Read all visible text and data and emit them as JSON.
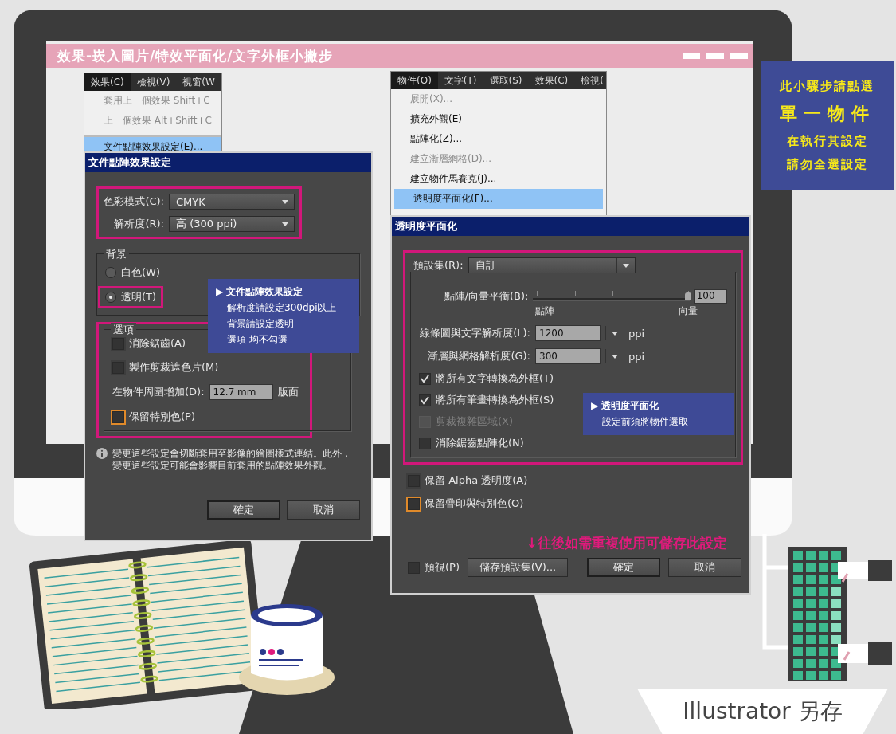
{
  "title_bar": {
    "title": "效果-崁入圖片/特效平面化/文字外框小撇步"
  },
  "effect_menu": {
    "menubar": [
      {
        "label": "效果(C)",
        "selected": true
      },
      {
        "label": "檢視(V)",
        "selected": false
      },
      {
        "label": "視窗(W",
        "selected": false
      }
    ],
    "items": [
      {
        "label": "套用上一個效果",
        "shortcut": "Shift+C",
        "disabled": true,
        "selected": false
      },
      {
        "label": "上一個效果",
        "shortcut": "Alt+Shift+C",
        "disabled": true,
        "selected": false
      },
      {
        "label": "文件點陣效果設定(E)...",
        "disabled": false,
        "selected": true
      }
    ]
  },
  "raster_dialog": {
    "title": "文件點陣效果設定",
    "selects": [
      {
        "label": "色彩模式(C):",
        "value": "CMYK"
      },
      {
        "label": "解析度(R):",
        "value": "高 (300 ppi)"
      }
    ],
    "background": {
      "title": "背景",
      "options": [
        {
          "label": "白色(W)",
          "selected": false
        },
        {
          "label": "透明(T)",
          "selected": true
        }
      ]
    },
    "options": {
      "title": "選項",
      "items": [
        {
          "kind": "checkbox",
          "label": "消除鋸齒(A)",
          "checked": false,
          "focused": false
        },
        {
          "kind": "checkbox",
          "label": "製作剪裁遮色片(M)",
          "checked": false,
          "focused": false
        },
        {
          "kind": "field",
          "label": "在物件周圍增加(D):",
          "value": "12.7 mm",
          "unit": "版面"
        },
        {
          "kind": "checkbox",
          "label": "保留特別色(P)",
          "checked": false,
          "focused": true
        }
      ]
    },
    "info": "變更這些設定會切斷套用至影像的繪圖樣式連結。此外，變更這些設定可能會影響目前套用的點陣效果外觀。",
    "buttons": [
      {
        "label": "確定",
        "default": true
      },
      {
        "label": "取消",
        "default": false
      }
    ],
    "callout": {
      "marker": "▶",
      "title": "文件點陣效果設定",
      "lines": [
        "解析度請設定300dpi以上",
        "背景請設定透明",
        "選項-均不勾選"
      ]
    }
  },
  "object_menu": {
    "menubar": [
      {
        "label": "物件(O)",
        "selected": true
      },
      {
        "label": "文字(T)",
        "selected": false
      },
      {
        "label": "選取(S)",
        "selected": false
      },
      {
        "label": "效果(C)",
        "selected": false
      },
      {
        "label": "檢視(",
        "selected": false
      }
    ],
    "items": [
      {
        "label": "展開(X)...",
        "disabled": true,
        "selected": false
      },
      {
        "label": "擴充外觀(E)",
        "disabled": false,
        "selected": false
      },
      {
        "label": "點陣化(Z)...",
        "disabled": false,
        "selected": false
      },
      {
        "label": "建立漸層網格(D)...",
        "disabled": true,
        "selected": false
      },
      {
        "label": "建立物件馬賽克(J)...",
        "disabled": false,
        "selected": false
      },
      {
        "label": "透明度平面化(F)...",
        "disabled": false,
        "selected": true
      }
    ]
  },
  "flatten_dialog": {
    "title": "透明度平面化",
    "preset": {
      "label": "預設集(R):",
      "value": "自訂"
    },
    "balance": {
      "label": "點陣/向量平衡(B):",
      "level": 1,
      "value": "100",
      "min_label": "點陣",
      "max_label": "向量"
    },
    "resolutions": [
      {
        "label": "線條圖與文字解析度(L):",
        "value": "1200",
        "unit": "ppi"
      },
      {
        "label": "漸層與網格解析度(G):",
        "value": "300",
        "unit": "ppi"
      }
    ],
    "checkboxes": [
      {
        "label": "將所有文字轉換為外框(T)",
        "checked": true,
        "disabled": false
      },
      {
        "label": "將所有筆畫轉換為外框(S)",
        "checked": true,
        "disabled": false
      },
      {
        "label": "剪裁複雜區域(X)",
        "checked": false,
        "disabled": true
      },
      {
        "label": "消除鋸齒點陣化(N)",
        "checked": false,
        "disabled": false
      }
    ],
    "callout": {
      "marker": "▶",
      "title": "透明度平面化",
      "lines": [
        "設定前須將物件選取"
      ]
    },
    "extra_checkboxes": [
      {
        "label": "保留 Alpha 透明度(A)",
        "checked": false,
        "focused": false
      },
      {
        "label": "保留疊印與特別色(O)",
        "checked": false,
        "focused": true
      }
    ],
    "hint": "↓往後如需重複使用可儲存此設定",
    "preview": {
      "label": "預視(P)",
      "checked": false
    },
    "buttons": [
      {
        "label": "儲存預設集(V)...",
        "default": false
      },
      {
        "label": "確定",
        "default": true
      },
      {
        "label": "取消",
        "default": false
      }
    ]
  },
  "side_note": {
    "lines": [
      {
        "text": "此小驟步請點選",
        "kind": "normal"
      },
      {
        "text": "單一物件",
        "kind": "large"
      },
      {
        "text": "在執行其設定",
        "kind": "normal"
      },
      {
        "text": "請勿全選設定",
        "kind": "normal"
      }
    ]
  },
  "footer_label": "Illustrator 另存"
}
